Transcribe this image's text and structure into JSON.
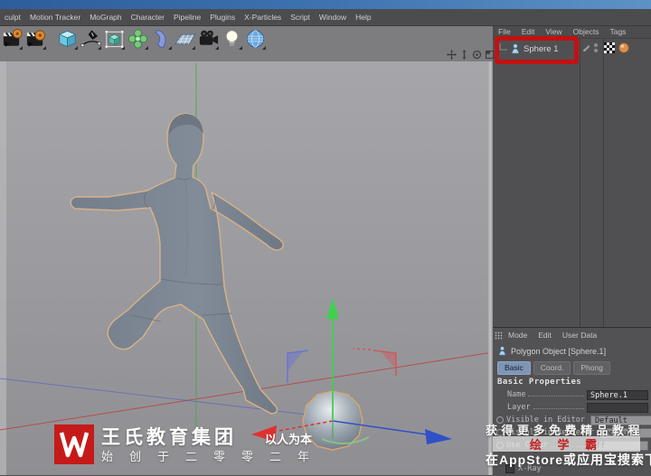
{
  "menubar": {
    "items": [
      "culpt",
      "Motion Tracker",
      "MoGraph",
      "Character",
      "Pipeline",
      "Plugins",
      "X-Particles",
      "Script",
      "Window",
      "Help"
    ]
  },
  "toolbar": {
    "icons": [
      "render-view",
      "render-settings",
      "cube-primitive",
      "spline-pen",
      "subdivision-surface",
      "mograph-cloner",
      "deformer",
      "floor-environment",
      "camera",
      "light",
      "sky"
    ]
  },
  "viewport": {
    "nav_icons": [
      "pan",
      "dolly",
      "rotate",
      "toggle-view"
    ]
  },
  "object_manager": {
    "menu_items": [
      "File",
      "Edit",
      "View",
      "Objects",
      "Tags"
    ],
    "object": {
      "name": "Sphere 1",
      "icon": "figure-object",
      "tags": [
        "uvw-tag",
        "phong-tag"
      ]
    }
  },
  "attribute_manager": {
    "menu_items": [
      "Mode",
      "Edit",
      "User Data"
    ],
    "object_title": "Polygon Object [Sphere.1]",
    "tabs": [
      "Basic",
      "Coord.",
      "Phong"
    ],
    "active_tab": "Basic",
    "section_title": "Basic Properties",
    "rows": [
      {
        "label": "Name",
        "value": "Sphere.1",
        "type": "input"
      },
      {
        "label": "Layer",
        "value": "",
        "type": "input"
      },
      {
        "label": "Visible in Editor",
        "value": "Default",
        "type": "dropdown"
      },
      {
        "label": "Visible in Renderer",
        "value": "Default",
        "type": "dropdown"
      },
      {
        "label": "Use Color",
        "value": "Off",
        "type": "dropdown"
      },
      {
        "label": "X-Ray",
        "value": "",
        "type": "checkbox"
      }
    ]
  },
  "annotation": {
    "highlight_color": "#c31111",
    "target": "Sphere 1"
  },
  "watermarks": {
    "bottom_left": {
      "logo_letter": "W",
      "company": "王氏教育集团",
      "slogan": "以人为本",
      "subtitle": "始创于二零零二年"
    },
    "overlay": {
      "line1": "获得更多免费精品教程",
      "brand": "绘 学 霸",
      "line3": "在AppStore或应用宝搜索下载"
    }
  },
  "colors": {
    "titlebar_blue": "#3a71ae",
    "annotation_red": "#c31111",
    "active_tab_blue": "#7e96b6",
    "axis_x_red": "#cc3333",
    "axis_y_green": "#3fae4f",
    "axis_z_blue": "#3050c8",
    "selection_outline_orange": "#d8b288",
    "viewport_gray": "#9b9b9f"
  }
}
